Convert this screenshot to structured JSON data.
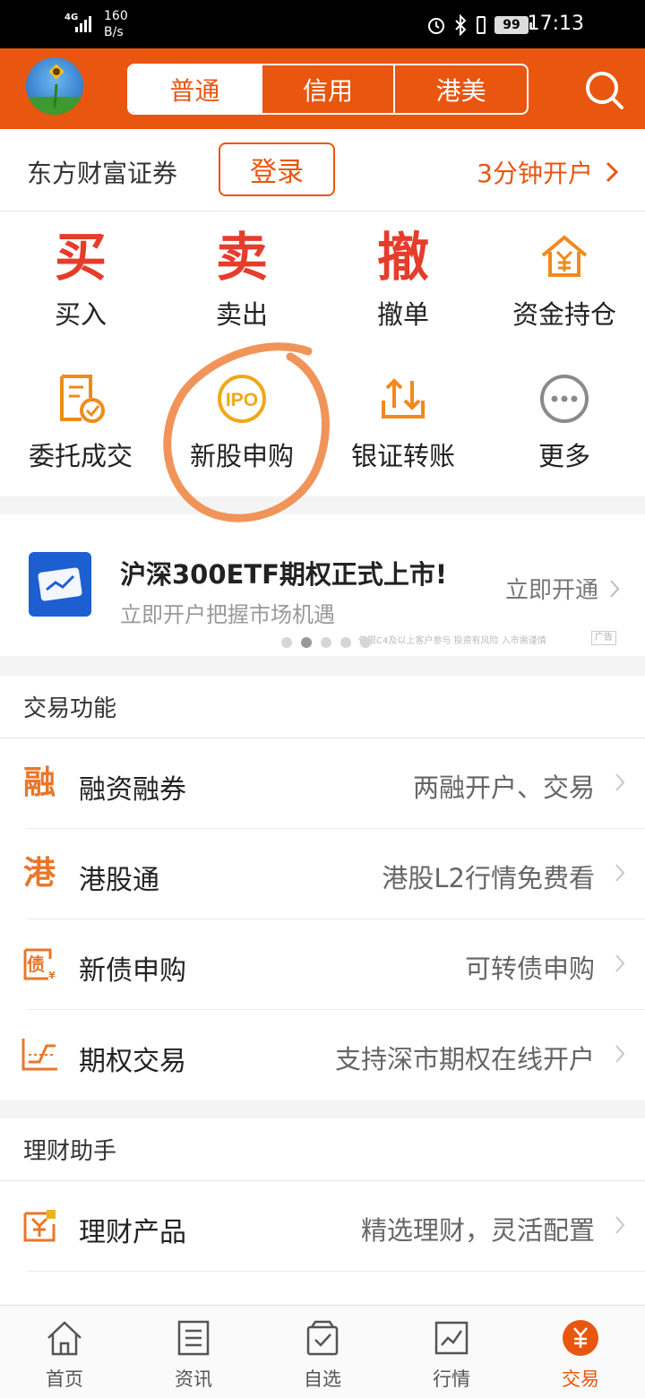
{
  "status_bar": {
    "network": "4G",
    "speed_value": "160",
    "speed_unit": "B/s",
    "battery": "99",
    "time": "17:13"
  },
  "header": {
    "tabs": [
      {
        "label": "普通",
        "active": true
      },
      {
        "label": "信用",
        "active": false
      },
      {
        "label": "港美",
        "active": false
      }
    ]
  },
  "account": {
    "broker": "东方财富证券",
    "login_label": "登录",
    "open_account": "3分钟开户"
  },
  "quick_actions": [
    {
      "glyph": "买",
      "label": "买入"
    },
    {
      "glyph": "卖",
      "label": "卖出"
    },
    {
      "glyph": "撤",
      "label": "撤单"
    },
    {
      "icon": "yuan-house-icon",
      "label": "资金持仓"
    },
    {
      "icon": "order-check-icon",
      "label": "委托成交"
    },
    {
      "icon": "ipo-icon",
      "icon_text": "IPO",
      "label": "新股申购"
    },
    {
      "icon": "transfer-icon",
      "label": "银证转账"
    },
    {
      "icon": "more-icon",
      "label": "更多"
    }
  ],
  "banner": {
    "title": "沪深300ETF期权正式上市!",
    "subtitle": "立即开户把握市场机遇",
    "cta": "立即开通",
    "note": "仅限C4及以上客户参与 投资有风险 入市需谨慎",
    "ad_tag": "广告",
    "active_dot": 1
  },
  "trade_section": {
    "title": "交易功能",
    "rows": [
      {
        "icon_text": "融",
        "name": "融资融券",
        "desc": "两融开户、交易"
      },
      {
        "icon_text": "港",
        "name": "港股通",
        "desc": "港股L2行情免费看"
      },
      {
        "icon": "bond-icon",
        "icon_text": "债",
        "name": "新债申购",
        "desc": "可转债申购"
      },
      {
        "icon": "option-chart-icon",
        "name": "期权交易",
        "desc": "支持深市期权在线开户"
      }
    ]
  },
  "wealth_section": {
    "title": "理财助手",
    "rows": [
      {
        "icon": "wealth-product-icon",
        "name": "理财产品",
        "desc": "精选理财，灵活配置"
      }
    ]
  },
  "tabbar": [
    {
      "label": "首页",
      "icon": "home-icon"
    },
    {
      "label": "资讯",
      "icon": "news-icon"
    },
    {
      "label": "自选",
      "icon": "watchlist-icon"
    },
    {
      "label": "行情",
      "icon": "market-icon"
    },
    {
      "label": "交易",
      "icon": "trade-icon",
      "active": true
    }
  ],
  "colors": {
    "brand": "#e8560f",
    "accent_red": "#e63c2c",
    "icon_orange": "#e8772a",
    "annotation": "#f0945a"
  }
}
